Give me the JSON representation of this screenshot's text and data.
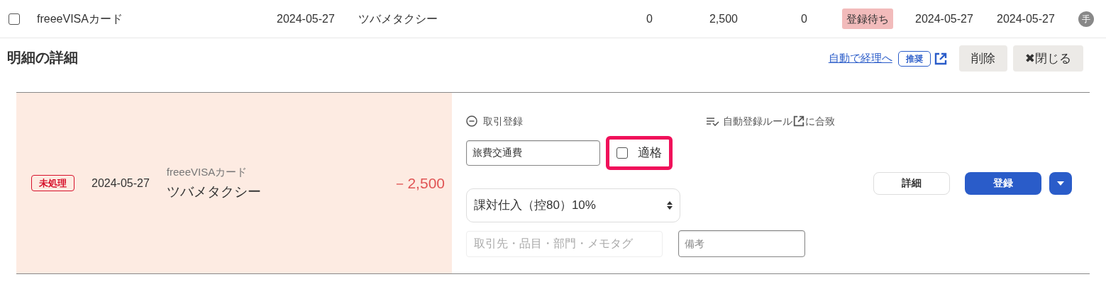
{
  "list_row": {
    "checked": false,
    "account": "freeeVISAカード",
    "date": "2024-05-27",
    "vendor": "ツバメタクシー",
    "column_4": "0",
    "column_5": "2,500",
    "column_6": "0",
    "status": "登録待ち",
    "date_2": "2024-05-27",
    "date_3": "2024-05-27",
    "badge": "手"
  },
  "detail_header": {
    "title": "明細の詳細",
    "auto_link": "自動で経理へ",
    "recommend_badge": "推奨",
    "buttons": [
      "削除",
      "✖閉じる"
    ]
  },
  "detail": {
    "status": "未処理",
    "date": "2024-05-27",
    "account": "freeeVISAカード",
    "vendor": "ツバメタクシー",
    "amount": "－2,500",
    "form": {
      "section": "取引登録",
      "expanded": true,
      "rule_before": "自動登録ルール",
      "rule_after": "に合致",
      "account_item": "旅費交通費",
      "qualified": {
        "label": "適格",
        "checked": false,
        "highlighted": true
      },
      "tax": "課対仕入（控80）10%",
      "tags_placeholder": "取引先・品目・部門・メモタグ",
      "memo_placeholder": "備考"
    },
    "buttons": [
      {
        "kind": "secondary",
        "label": "詳細"
      },
      {
        "kind": "primary",
        "label": "登録"
      },
      {
        "kind": "dropdown"
      }
    ]
  }
}
